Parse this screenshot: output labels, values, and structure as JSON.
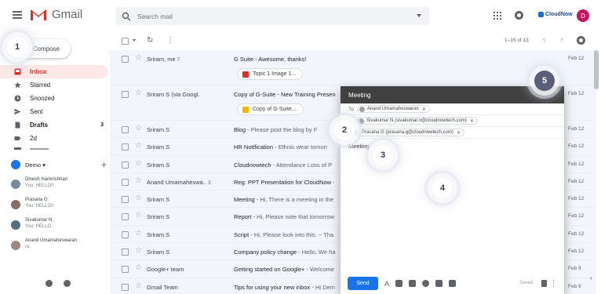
{
  "header": {
    "app_name": "Gmail",
    "search_placeholder": "Search mail",
    "brand": "CloudNow",
    "avatar_initial": "D"
  },
  "sidebar": {
    "compose_label": "Compose",
    "items": [
      {
        "label": "Inbox",
        "icon": "inbox-icon"
      },
      {
        "label": "Starred",
        "icon": "star-icon"
      },
      {
        "label": "Snoozed",
        "icon": "clock-icon"
      },
      {
        "label": "Sent",
        "icon": "send-icon"
      },
      {
        "label": "Drafts",
        "icon": "draft-icon",
        "count": "3"
      },
      {
        "label": "2d",
        "icon": "label-icon"
      }
    ],
    "account_label": "Demo",
    "contacts": [
      {
        "name": "Dinesh Harikrishnan",
        "status": "You: HELLO!!",
        "color": "#7b8a9a"
      },
      {
        "name": "Prasana G",
        "status": "You: HELLO!!",
        "color": "#8d6e63"
      },
      {
        "name": "Sivakumar N",
        "status": "You: HELLO",
        "color": "#546e7a"
      },
      {
        "name": "Anand Umamaheswaran",
        "status": "ra",
        "color": "#a1887f"
      }
    ]
  },
  "toolbar": {
    "refresh_glyph": "↻",
    "more_glyph": "⋮",
    "pagination": "1–15 of 13",
    "prev_glyph": "‹",
    "next_glyph": "›"
  },
  "emails": [
    {
      "sender": "Sriram, me",
      "count": "7",
      "subject": "G Suite - Awesome, thanks!",
      "snippet": "",
      "date": "Feb 12",
      "attachment": "Topic 1 Image 1...",
      "attachment_type": "image"
    },
    {
      "sender": "Sriram S (via Googl.",
      "count": "",
      "subject": "Copy of G-Suite - New Training Presen",
      "snippet": "",
      "date": "Feb 12",
      "attachment": "Copy of G-Suite...",
      "attachment_type": "slides"
    },
    {
      "sender": "Sriram S",
      "count": "",
      "subject": "Blog",
      "snippet": " - Please post the blog by F",
      "date": "Feb 12",
      "attachment": ""
    },
    {
      "sender": "Sriram S",
      "count": "",
      "subject": "HR Notification",
      "snippet": " - Ethnic wear tomorr",
      "date": "Feb 12",
      "attachment": ""
    },
    {
      "sender": "Sriram S",
      "count": "",
      "subject": "Cloudnowtech",
      "snippet": " - Attendance Loss of P",
      "date": "Feb 12",
      "attachment": ""
    },
    {
      "sender": "Anand Umamaheswa..",
      "count": "3",
      "subject": "Reg: PPT Presentation for CloudNow",
      "snippet": " -",
      "date": "Feb 12",
      "attachment": ""
    },
    {
      "sender": "Sriram S",
      "count": "",
      "subject": "Meeting",
      "snippet": " - Hi, There is a meeting in the",
      "date": "Feb 12",
      "attachment": ""
    },
    {
      "sender": "Sriram S",
      "count": "",
      "subject": "Report",
      "snippet": " - Hi, Please note that tomorrow",
      "date": "Feb 12",
      "attachment": ""
    },
    {
      "sender": "Sriram S",
      "count": "",
      "subject": "Script",
      "snippet": " - Hi, Please look into this. ~ Tha",
      "date": "Feb 12",
      "attachment": ""
    },
    {
      "sender": "Sriram S",
      "count": "",
      "subject": "Company policy change",
      "snippet": " - Hello, We ha",
      "date": "Feb 12",
      "attachment": ""
    },
    {
      "sender": "Google+ team",
      "count": "",
      "subject": "Getting started on Google+",
      "snippet": " - Welcome",
      "date": "Feb 9",
      "attachment": ""
    },
    {
      "sender": "Gmail Team",
      "count": "",
      "subject": "Tips for using your new inbox",
      "snippet": " - Hi Dem",
      "date": "Feb 9",
      "attachment": ""
    }
  ],
  "compose_window": {
    "title": "Meeting",
    "to_label": "To",
    "recipients": [
      "Anand Umamaheswaran",
      "Sivakumar N (sivakumar.n@cloudnowtech.com)",
      "Prasana G (prasana.g@cloudnowtech.com)"
    ],
    "subject": "Meeting",
    "send_label": "Send",
    "saved_label": "Saved",
    "format_glyph": "A",
    "more_glyph": "⋮",
    "remove_glyph": "✕"
  },
  "steps": [
    "1",
    "2",
    "3",
    "4",
    "5"
  ],
  "colors": {
    "accent_red": "#d93025",
    "send_blue": "#1a73e8",
    "compose_header": "#404040"
  }
}
